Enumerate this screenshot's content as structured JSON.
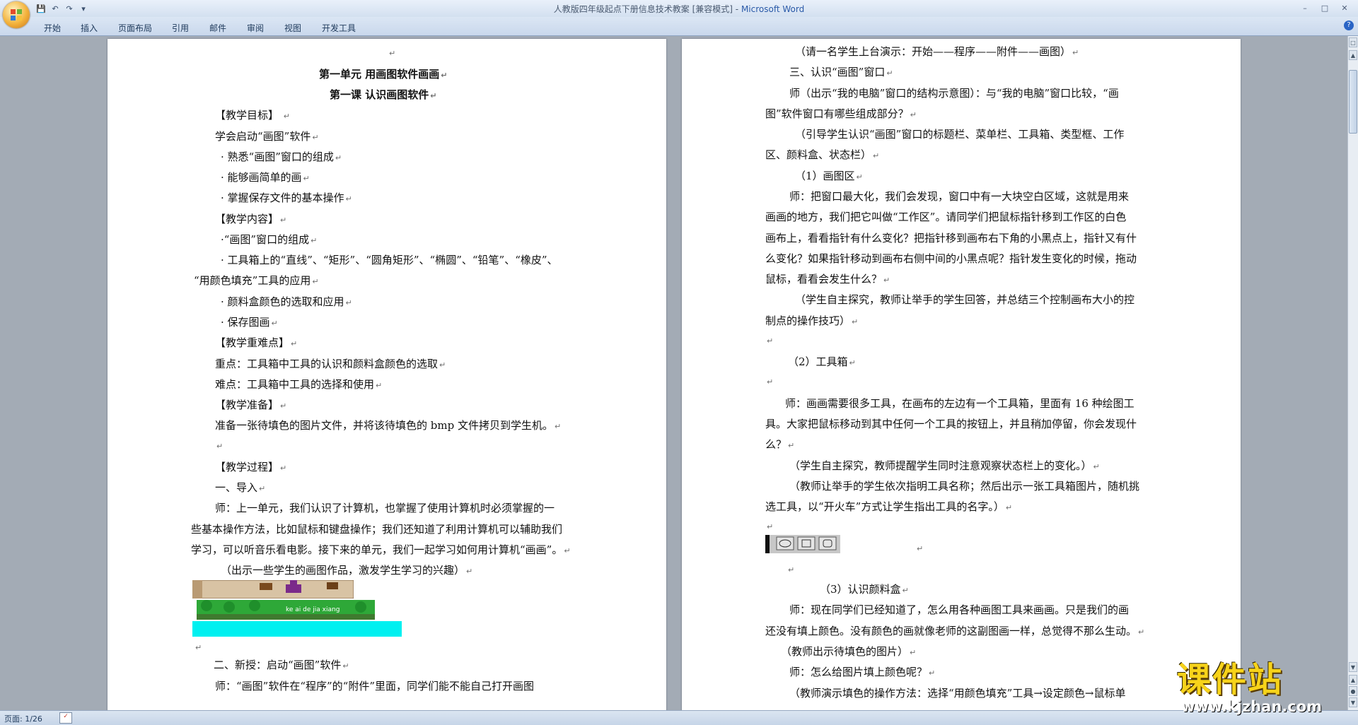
{
  "window": {
    "title": "人教版四年级起点下册信息技术教案 [兼容模式]",
    "app_name": "Microsoft Word",
    "title_separator": " - "
  },
  "qat": {
    "save_icon": "save-icon",
    "undo_icon": "undo-icon",
    "redo_icon": "redo-icon",
    "customize_icon": "customize-icon"
  },
  "ribbon": {
    "tabs": [
      "开始",
      "插入",
      "页面布局",
      "引用",
      "邮件",
      "审阅",
      "视图",
      "开发工具"
    ]
  },
  "status": {
    "page": "页面: 1/26"
  },
  "watermark": {
    "brand": "课件站",
    "url": "www.kjzhan.com"
  },
  "page_left": {
    "lines": [
      "第一单元  用画图软件画画",
      "第一课  认识画图软件",
      "【教学目标】 ",
      "学会启动“画图”软件",
      "· 熟悉“画图”窗口的组成",
      "· 能够画简单的画",
      "· 掌握保存文件的基本操作",
      "【教学内容】",
      "·“画图”窗口的组成",
      "· 工具箱上的“直线”、“矩形”、“圆角矩形”、“椭圆”、“铅笔”、“橡皮”、",
      "“用颜色填充”工具的应用",
      "· 颜料盒颜色的选取和应用",
      "· 保存图画",
      "【教学重难点】",
      "重点：工具箱中工具的认识和颜料盒颜色的选取",
      "难点：工具箱中工具的选择和使用",
      "【教学准备】",
      "准备一张待填色的图片文件，并将该待填色的 bmp 文件拷贝到学生机。",
      "",
      "【教学过程】",
      "一、导入",
      "师：上一单元，我们认识了计算机，也掌握了使用计算机时必须掌握的一",
      "些基本操作方法，比如鼠标和键盘操作；我们还知道了利用计算机可以辅助我们",
      "学习，可以听音乐看电影。接下来的单元，我们一起学习如何用计算机“画画”。",
      "（出示一些学生的画图作品，激发学生学习的兴趣）",
      "二、新授：启动“画图”软件",
      "师：“画图”软件在“程序”的“附件”里面，同学们能不能自己打开画图"
    ],
    "image_caption": "ke ai de jia xiang"
  },
  "page_right": {
    "lines": [
      "（请一名学生上台演示：开始——程序——附件——画图）",
      "三、认识“画图”窗口",
      "师（出示“我的电脑”窗口的结构示意图）：与“我的电脑”窗口比较，“画",
      "图”软件窗口有哪些组成部分？",
      "（引导学生认识“画图”窗口的标题栏、菜单栏、工具箱、类型框、工作",
      "区、颜料盒、状态栏）",
      "（1）画图区",
      "师：把窗口最大化，我们会发现，窗口中有一大块空白区域，这就是用来",
      "画画的地方，我们把它叫做“工作区”。请同学们把鼠标指针移到工作区的白色",
      "画布上，看看指针有什么变化？把指针移到画布右下角的小黑点上，指针又有什",
      "么变化？如果指针移动到画布右侧中间的小黑点呢？指针发生变化的时候，拖动",
      "鼠标，看看会发生什么？",
      "（学生自主探究，教师让举手的学生回答，并总结三个控制画布大小的控",
      "制点的操作技巧）",
      "",
      "（2）工具箱",
      "",
      "师：画画需要很多工具，在画布的左边有一个工具箱，里面有 16 种绘图工",
      "具。大家把鼠标移动到其中任何一个工具的按钮上，并且稍加停留，你会发现什",
      "么？",
      "（学生自主探究，教师提醒学生同时注意观察状态栏上的变化。）",
      "（教师让举手的学生依次指明工具名称；然后出示一张工具箱图片，随机挑",
      "选工具，以“开火车”方式让学生指出工具的名字。）",
      "",
      "",
      "（3）认识颜料盒",
      "师：现在同学们已经知道了，怎么用各种画图工具来画画。只是我们的画",
      "还没有填上颜色。没有颜色的画就像老师的这副图画一样，总觉得不那么生动。",
      "（教师出示待填色的图片）",
      "师：怎么给图片填上颜色呢？",
      "（教师演示填色的操作方法：选择“用颜色填充”工具→设定颜色→鼠标单"
    ]
  }
}
